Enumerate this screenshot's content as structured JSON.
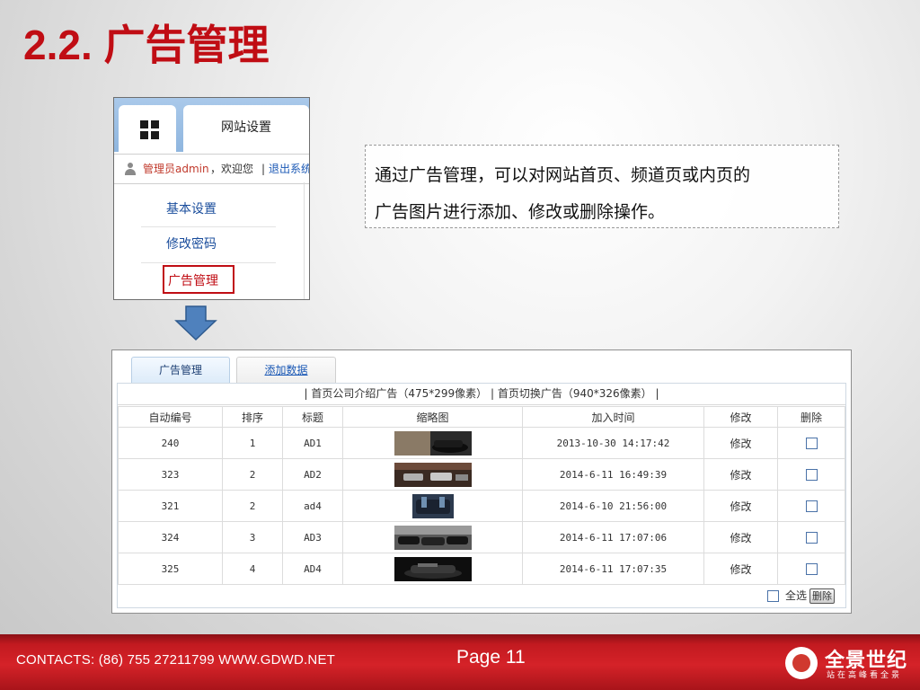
{
  "slide": {
    "title": "2.2. 广告管理",
    "description_line1": "通过广告管理，可以对网站首页、频道页或内页的",
    "description_line2": "广告图片进行添加、修改或删除操作。"
  },
  "admin_panel": {
    "tab_label": "网站设置",
    "user_admin": "管理员admin",
    "user_welcome": "，欢迎您",
    "user_sep": "|",
    "user_logout": "退出系统",
    "menu": [
      "基本设置",
      "修改密码",
      "广告管理"
    ]
  },
  "ad_manager": {
    "tabs": [
      "广告管理",
      "添加数据"
    ],
    "sizes_text": "| 首页公司介绍广告（475*299像素） | 首页切换广告（940*326像素） |",
    "columns": [
      "自动编号",
      "排序",
      "标题",
      "缩略图",
      "加入时间",
      "修改",
      "删除"
    ],
    "rows": [
      {
        "id": "240",
        "order": "1",
        "title": "AD1",
        "added": "2013-10-30 14:17:42",
        "edit": "修改"
      },
      {
        "id": "323",
        "order": "2",
        "title": "AD2",
        "added": "2014-6-11 16:49:39",
        "edit": "修改"
      },
      {
        "id": "321",
        "order": "2",
        "title": "ad4",
        "added": "2014-6-10 21:56:00",
        "edit": "修改"
      },
      {
        "id": "324",
        "order": "3",
        "title": "AD3",
        "added": "2014-6-11 17:07:06",
        "edit": "修改"
      },
      {
        "id": "325",
        "order": "4",
        "title": "AD4",
        "added": "2014-6-11 17:07:35",
        "edit": "修改"
      }
    ],
    "select_all": "全选",
    "delete_button": "删除"
  },
  "footer": {
    "contacts": "CONTACTS: (86) 755 27211799 WWW.GDWD.NET",
    "page": "Page 11",
    "logo_name": "全景世纪",
    "logo_tagline": "站在高峰看全景"
  },
  "colors": {
    "title_red": "#c00d14",
    "footer_red": "#d52228",
    "arrow_blue": "#4f81bd",
    "link_blue": "#1a58b5"
  },
  "icons": [
    "grid-icon",
    "user-icon",
    "down-arrow-icon",
    "thumbnail-car",
    "checkbox",
    "logo-mark-icon"
  ]
}
